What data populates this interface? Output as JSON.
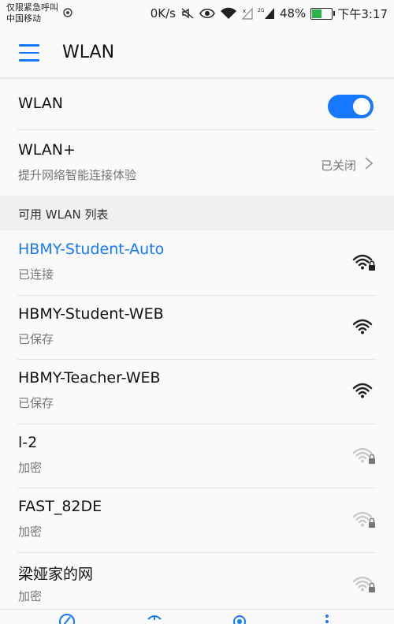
{
  "status_bar": {
    "carrier_line1": "仅限紧急呼叫",
    "carrier_line2": "中国移动",
    "speed": "0K/s",
    "network_type": "2G",
    "battery": "48%",
    "battery_level": 0.48,
    "time": "下午3:17"
  },
  "appbar": {
    "title": "WLAN"
  },
  "wlan_toggle": {
    "label": "WLAN",
    "on": true
  },
  "wlan_plus": {
    "title": "WLAN+",
    "subtitle": "提升网络智能连接体验",
    "status": "已关闭"
  },
  "section": {
    "title": "可用 WLAN 列表"
  },
  "networks": [
    {
      "ssid": "HBMY-Student-Auto",
      "status": "已连接",
      "signal": 4,
      "locked": true,
      "connected": true
    },
    {
      "ssid": "HBMY-Student-WEB",
      "status": "已保存",
      "signal": 4,
      "locked": false,
      "connected": false
    },
    {
      "ssid": "HBMY-Teacher-WEB",
      "status": "已保存",
      "signal": 4,
      "locked": false,
      "connected": false
    },
    {
      "ssid": "l-2",
      "status": "加密",
      "signal": 2,
      "locked": true,
      "connected": false
    },
    {
      "ssid": "FAST_82DE",
      "status": "加密",
      "signal": 2,
      "locked": true,
      "connected": false
    },
    {
      "ssid": "梁娅家的网",
      "status": "加密",
      "signal": 2,
      "locked": true,
      "connected": false
    }
  ],
  "colors": {
    "accent": "#1677ff",
    "divider": "#e4e4e4"
  },
  "bottom_nav_icons": [
    "edit-icon",
    "wifi-signal-icon",
    "gear-icon",
    "more-vertical-icon"
  ]
}
